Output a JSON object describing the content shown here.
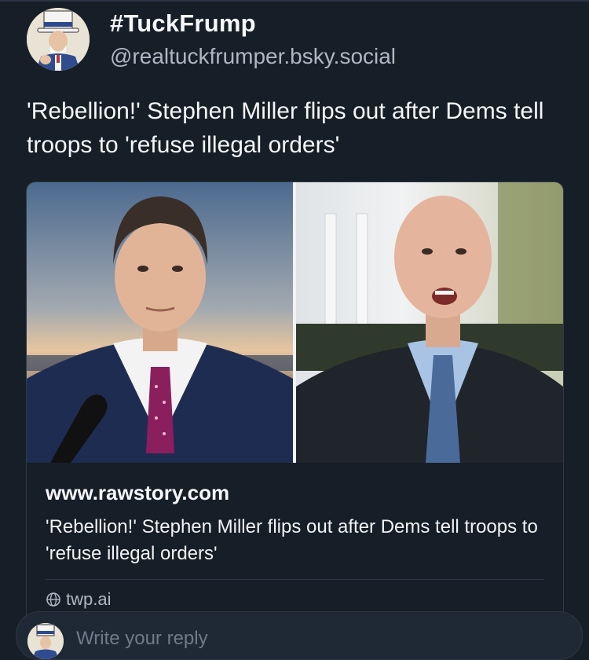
{
  "author": {
    "display_name": "#TuckFrump",
    "handle": "@realtuckfrumper.bsky.social"
  },
  "post": {
    "text": "'Rebellion!' Stephen Miller flips out after Dems tell troops to 'refuse illegal orders'"
  },
  "link_card": {
    "domain": "www.rawstory.com",
    "title": "'Rebellion!' Stephen Miller flips out after Dems tell troops to 'refuse illegal orders'",
    "source": "twp.ai",
    "source_icon": "globe-icon"
  },
  "reply_bar": {
    "placeholder": "Write your reply"
  },
  "colors": {
    "background": "#161e27",
    "text": "#f5f7fa",
    "muted": "#aeb8c4",
    "border": "#2e3a48"
  }
}
